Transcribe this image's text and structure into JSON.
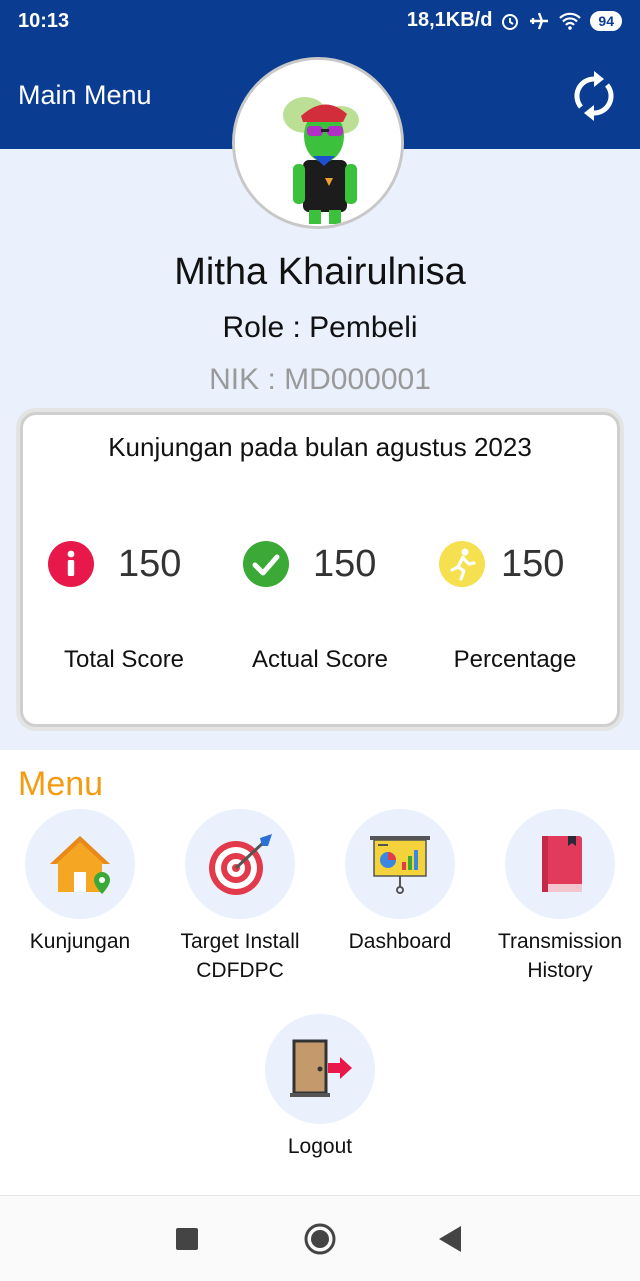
{
  "status_bar": {
    "time": "10:13",
    "speed": "18,1KB/d",
    "battery": "94"
  },
  "app_bar": {
    "title": "Main Menu",
    "refresh_icon": "refresh-icon"
  },
  "profile": {
    "name": "Mitha Khairulnisa",
    "role": "Role : Pembeli",
    "nik": "NIK : MD000001"
  },
  "stats": {
    "title": "Kunjungan pada bulan agustus 2023",
    "items": [
      {
        "value": "150",
        "label": "Total Score",
        "icon": "info-icon",
        "color": "#e8194a"
      },
      {
        "value": "150",
        "label": "Actual Score",
        "icon": "check-icon",
        "color": "#3aa935"
      },
      {
        "value": "150",
        "label": "Percentage",
        "icon": "runner-icon",
        "color": "#f5e050"
      }
    ]
  },
  "menu": {
    "heading": "Menu",
    "heading_color": "#f39c12",
    "items": [
      {
        "label": "Kunjungan",
        "icon": "house-location-icon"
      },
      {
        "label": "Target Install CDFDPC",
        "icon": "target-icon"
      },
      {
        "label": "Dashboard",
        "icon": "dashboard-board-icon"
      },
      {
        "label": "Transmission History",
        "icon": "book-icon"
      },
      {
        "label": "Logout",
        "icon": "logout-door-icon"
      }
    ]
  },
  "colors": {
    "primary": "#0a3d91",
    "background": "#eaf1fd"
  }
}
